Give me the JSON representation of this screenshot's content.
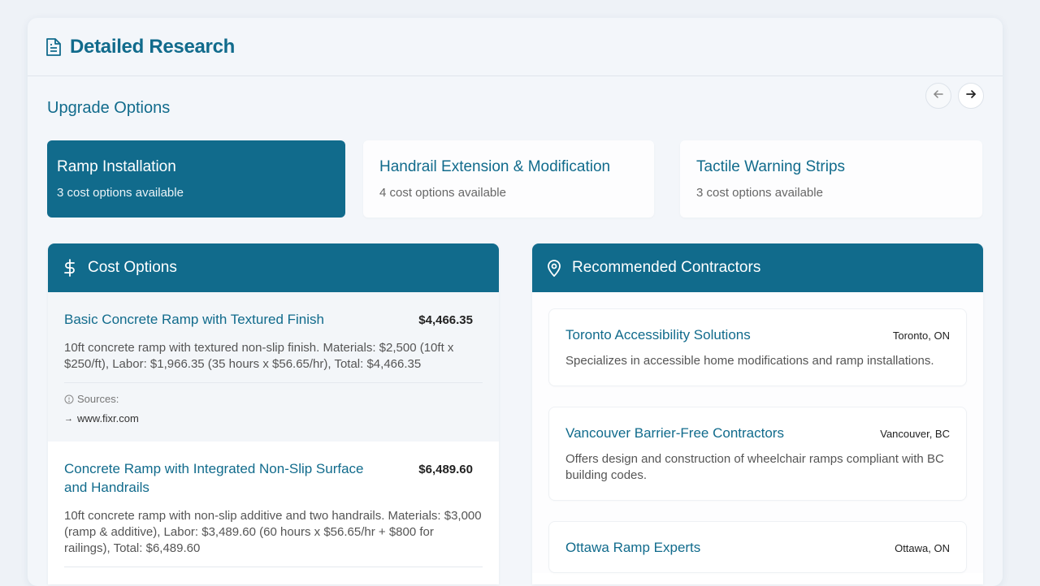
{
  "header": {
    "title": "Detailed Research",
    "icon": "document-icon"
  },
  "section_title": "Upgrade Options",
  "nav": {
    "prev_icon": "arrow-left-icon",
    "next_icon": "arrow-right-icon"
  },
  "options": [
    {
      "title": "Ramp Installation",
      "subtitle": "3 cost options available",
      "active": true
    },
    {
      "title": "Handrail Extension & Modification",
      "subtitle": "4 cost options available",
      "active": false
    },
    {
      "title": "Tactile Warning Strips",
      "subtitle": "3 cost options available",
      "active": false
    }
  ],
  "cost_options": {
    "title": "Cost Options",
    "icon": "dollar-icon",
    "sources_label": "Sources:",
    "items": [
      {
        "title": "Basic Concrete Ramp with Textured Finish",
        "price": "$4,466.35",
        "description": "10ft concrete ramp with textured non-slip finish. Materials: $2,500 (10ft x $250/ft), Labor: $1,966.35 (35 hours x $56.65/hr), Total: $4,466.35",
        "source": "www.fixr.com"
      },
      {
        "title": "Concrete Ramp with Integrated Non-Slip Surface and Handrails",
        "price": "$6,489.60",
        "description": "10ft concrete ramp with non-slip additive and two handrails. Materials: $3,000 (ramp & additive), Labor: $3,489.60 (60 hours x $56.65/hr + $800 for railings), Total: $6,489.60"
      }
    ]
  },
  "contractors": {
    "title": "Recommended Contractors",
    "icon": "location-pin-icon",
    "items": [
      {
        "name": "Toronto Accessibility Solutions",
        "location": "Toronto, ON",
        "description": "Specializes in accessible home modifications and ramp installations."
      },
      {
        "name": "Vancouver Barrier-Free Contractors",
        "location": "Vancouver, BC",
        "description": "Offers design and construction of wheelchair ramps compliant with BC building codes."
      },
      {
        "name": "Ottawa Ramp Experts",
        "location": "Ottawa, ON",
        "description": ""
      }
    ]
  },
  "colors": {
    "accent": "#116b8c",
    "background": "#eef2f7"
  }
}
